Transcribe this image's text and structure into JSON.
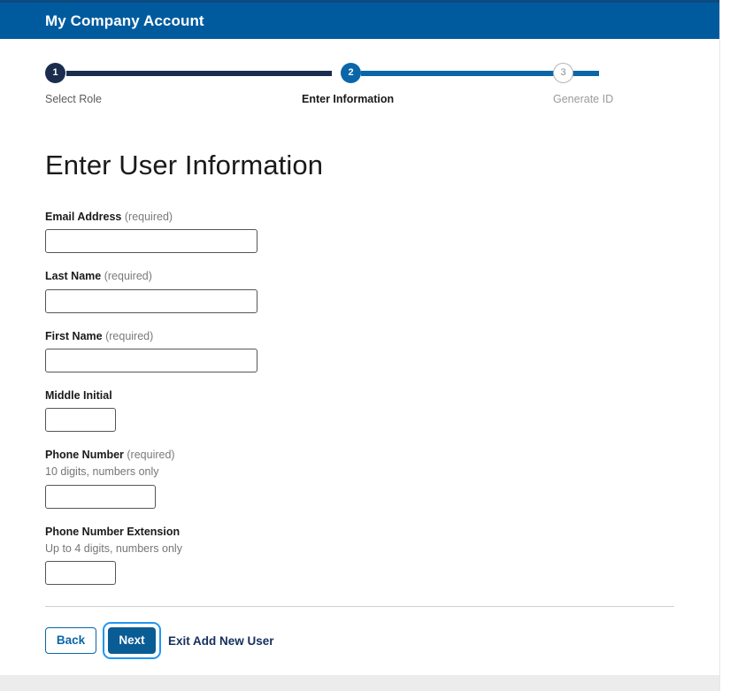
{
  "header": {
    "app_title": "My Company Account",
    "bar_color": "#005b9e"
  },
  "stepper": {
    "steps": [
      {
        "number": "1",
        "label": "Select Role",
        "state": "completed"
      },
      {
        "number": "2",
        "label": "Enter Information",
        "state": "active"
      },
      {
        "number": "3",
        "label": "Generate ID",
        "state": "upcoming"
      }
    ],
    "completed_color": "#1b2c4f",
    "active_color": "#0a66a8",
    "upcoming_color": "#b5b5b5"
  },
  "main": {
    "page_title": "Enter User Information",
    "fields": [
      {
        "label": "Email Address",
        "required_note": "(required)",
        "hint": "",
        "value": "",
        "placeholder": "",
        "size": "lg"
      },
      {
        "label": "Last Name",
        "required_note": "(required)",
        "hint": "",
        "value": "",
        "placeholder": "",
        "size": "lg"
      },
      {
        "label": "First Name",
        "required_note": "(required)",
        "hint": "",
        "value": "",
        "placeholder": "",
        "size": "lg"
      },
      {
        "label": "Middle Initial",
        "required_note": "",
        "hint": "",
        "value": "",
        "placeholder": "",
        "size": "sm"
      },
      {
        "label": "Phone Number",
        "required_note": "(required)",
        "hint": "10 digits, numbers only",
        "value": "",
        "placeholder": "",
        "size": "md"
      },
      {
        "label": "Phone Number Extension",
        "required_note": "",
        "hint": "Up to 4 digits, numbers only",
        "value": "",
        "placeholder": "",
        "size": "sm"
      }
    ]
  },
  "actions": {
    "back_label": "Back",
    "next_label": "Next",
    "exit_label": "Exit Add New User",
    "focused_button": "Next",
    "focus_ring_color": "#2196f3",
    "primary_color": "#0a5c95"
  }
}
